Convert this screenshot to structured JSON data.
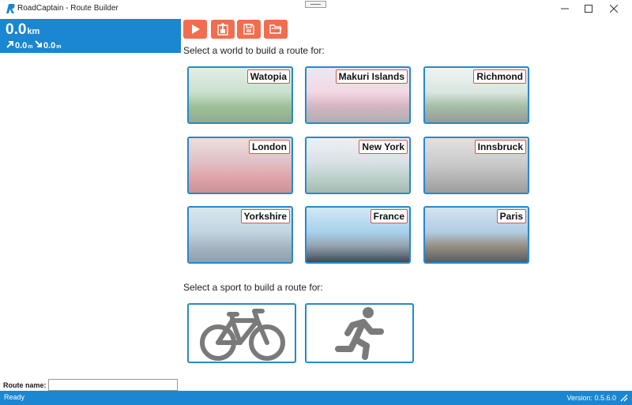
{
  "window": {
    "title": "RoadCaptain - Route Builder",
    "accent": "#1b86d1"
  },
  "route_info": {
    "distance_value": "0.0",
    "distance_unit": "km",
    "ascent_value": "0.0",
    "ascent_unit": "m",
    "descent_value": "0.0",
    "descent_unit": "m"
  },
  "toolbar": {
    "color": "#f26d4f",
    "buttons": [
      {
        "name": "play",
        "icon": "play-icon"
      },
      {
        "name": "export",
        "icon": "export-icon"
      },
      {
        "name": "save",
        "icon": "save-icon"
      },
      {
        "name": "open",
        "icon": "folder-icon"
      }
    ]
  },
  "worlds": {
    "prompt": "Select a world to build a route for:",
    "items": [
      {
        "name": "Watopia"
      },
      {
        "name": "Makuri Islands"
      },
      {
        "name": "Richmond"
      },
      {
        "name": "London"
      },
      {
        "name": "New York"
      },
      {
        "name": "Innsbruck"
      },
      {
        "name": "Yorkshire"
      },
      {
        "name": "France"
      },
      {
        "name": "Paris"
      }
    ]
  },
  "sports": {
    "prompt": "Select a sport to build a route for:",
    "items": [
      {
        "name": "cycling",
        "icon": "bicycle-icon"
      },
      {
        "name": "running",
        "icon": "runner-icon"
      }
    ]
  },
  "route_name": {
    "label": "Route name:",
    "value": ""
  },
  "status": {
    "text": "Ready",
    "version": "Version: 0.5.6.0"
  }
}
